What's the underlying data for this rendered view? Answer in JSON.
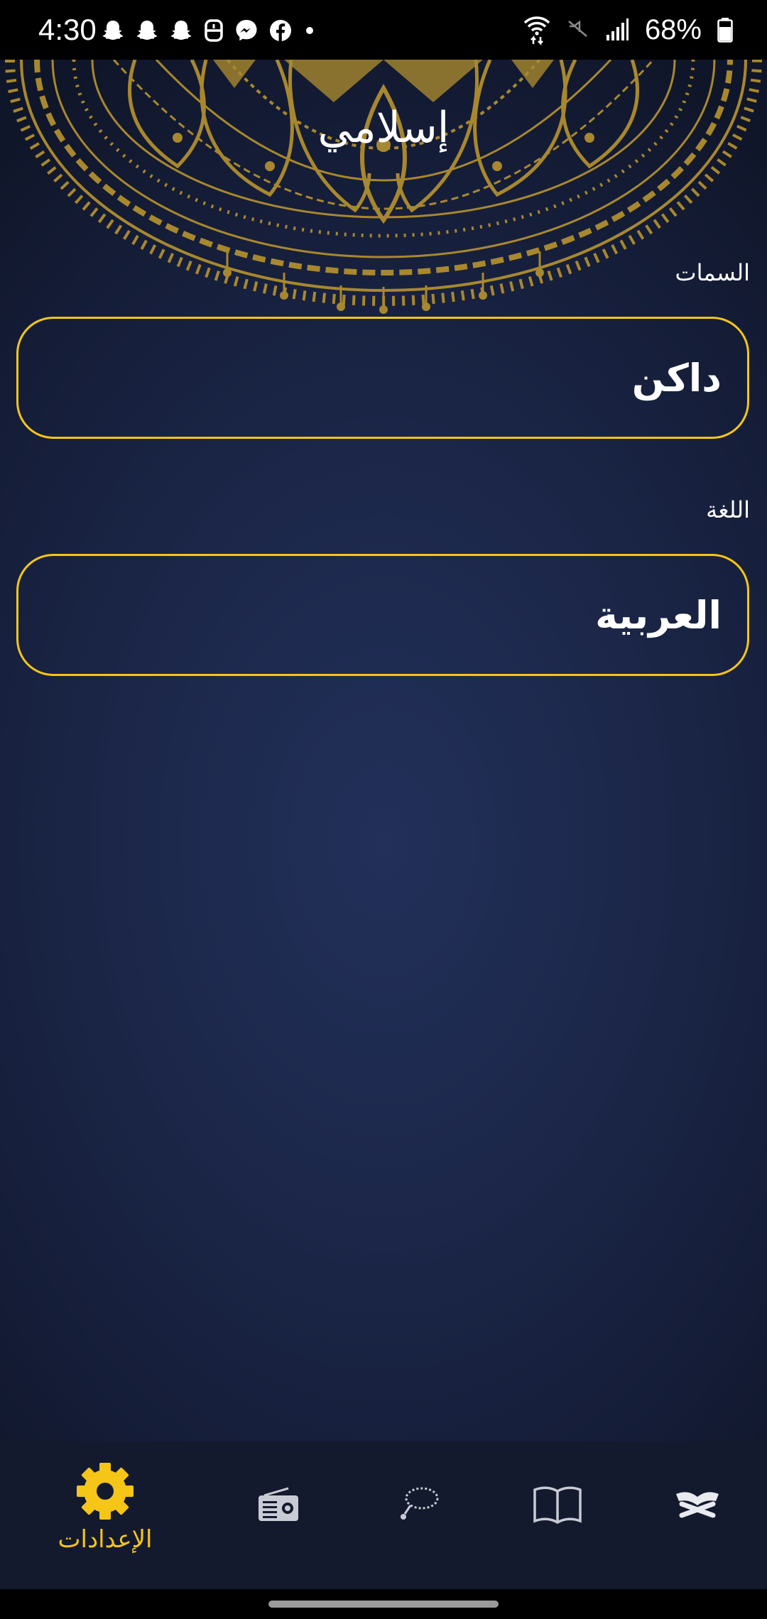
{
  "status_bar": {
    "time": "4:30",
    "battery": "68%",
    "left_icons": [
      "snapchat-icon",
      "snapchat-icon",
      "snapchat-icon",
      "dnd-icon",
      "messenger-icon",
      "facebook-icon",
      "dot-icon"
    ],
    "right_icons": [
      "wifi-icon",
      "mute-icon",
      "signal-icon",
      "battery-icon"
    ]
  },
  "header": {
    "title": "إسلامي"
  },
  "settings": {
    "theme": {
      "label": "السمات",
      "value": "داكن"
    },
    "language": {
      "label": "اللغة",
      "value": "العربية"
    }
  },
  "bottom_nav": {
    "items": [
      {
        "name": "settings",
        "label": "الإعدادات",
        "icon": "gear-icon",
        "active": true
      },
      {
        "name": "radio",
        "label": "",
        "icon": "radio-icon",
        "active": false
      },
      {
        "name": "tasbeeh",
        "label": "",
        "icon": "prayer-beads-icon",
        "active": false
      },
      {
        "name": "hadith",
        "label": "",
        "icon": "book-icon",
        "active": false
      },
      {
        "name": "quran",
        "label": "",
        "icon": "quran-icon",
        "active": false
      }
    ]
  },
  "colors": {
    "accent": "#f5c518",
    "mandala": "#a8882e",
    "background": "#1b2648",
    "nav_background": "#141a2e"
  }
}
